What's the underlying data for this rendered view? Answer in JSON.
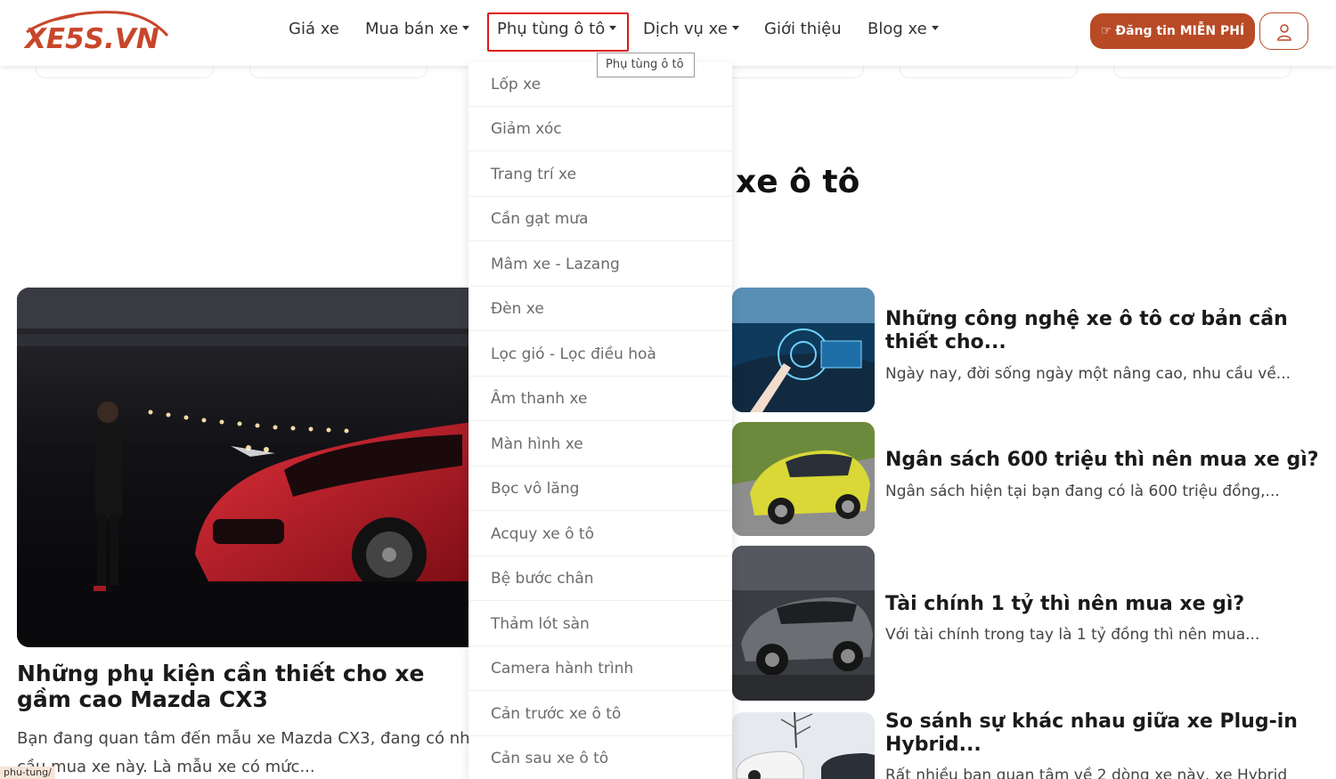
{
  "header": {
    "logo_text": "XE5S.VN",
    "nav": [
      {
        "label": "Giá xe",
        "has_caret": false
      },
      {
        "label": "Mua bán xe",
        "has_caret": true
      },
      {
        "label": "Phụ tùng ô tô",
        "has_caret": true
      },
      {
        "label": "Dịch vụ xe",
        "has_caret": true
      },
      {
        "label": "Giới thiệu",
        "has_caret": false
      },
      {
        "label": "Blog xe",
        "has_caret": true
      }
    ],
    "tooltip": "Phụ tùng ô tô",
    "post_button": "Đăng tin MIỄN PHÍ",
    "accent_color": "#b84a26",
    "highlight_color": "#e01818"
  },
  "dropdown": {
    "items": [
      "Lốp xe",
      "Giảm xóc",
      "Trang trí xe",
      "Cần gạt mưa",
      "Mâm xe - Lazang",
      "Đèn xe",
      "Lọc gió - Lọc điều hoà",
      "Âm thanh xe",
      "Màn hình xe",
      "Bọc vô lăng",
      "Acquy xe ô tô",
      "Bệ bước chân",
      "Thảm lót sàn",
      "Camera hành trình",
      "Cản trước xe ô tô",
      "Cản sau xe ô tô"
    ]
  },
  "main": {
    "section_title": "xe ô tô",
    "featured": {
      "title": "Những phụ kiện cần thiết cho xe gầm cao Mazda CX3",
      "excerpt": "Bạn đang quan tâm đến mẫu xe Mazda CX3, đang có nhu cầu mua xe này. Là mẫu xe có mức..."
    },
    "articles": [
      {
        "title": "Những công nghệ xe ô tô cơ bản cần thiết cho...",
        "excerpt": "Ngày nay, đời sống ngày một nâng cao, nhu cầu về..."
      },
      {
        "title": "Ngân sách 600 triệu thì nên mua xe gì?",
        "excerpt": "Ngân sách hiện tại bạn đang có là 600 triệu đồng,..."
      },
      {
        "title": "Tài chính 1 tỷ thì nên mua xe gì?",
        "excerpt": "Với tài chính trong tay là 1 tỷ đồng thì nên mua..."
      },
      {
        "title": "So sánh sự khác nhau giữa xe Plug-in Hybrid...",
        "excerpt": "Rất nhiều bạn quan tâm về 2 dòng xe này, xe Hybrid"
      }
    ]
  },
  "status_url": "phu-tung/"
}
